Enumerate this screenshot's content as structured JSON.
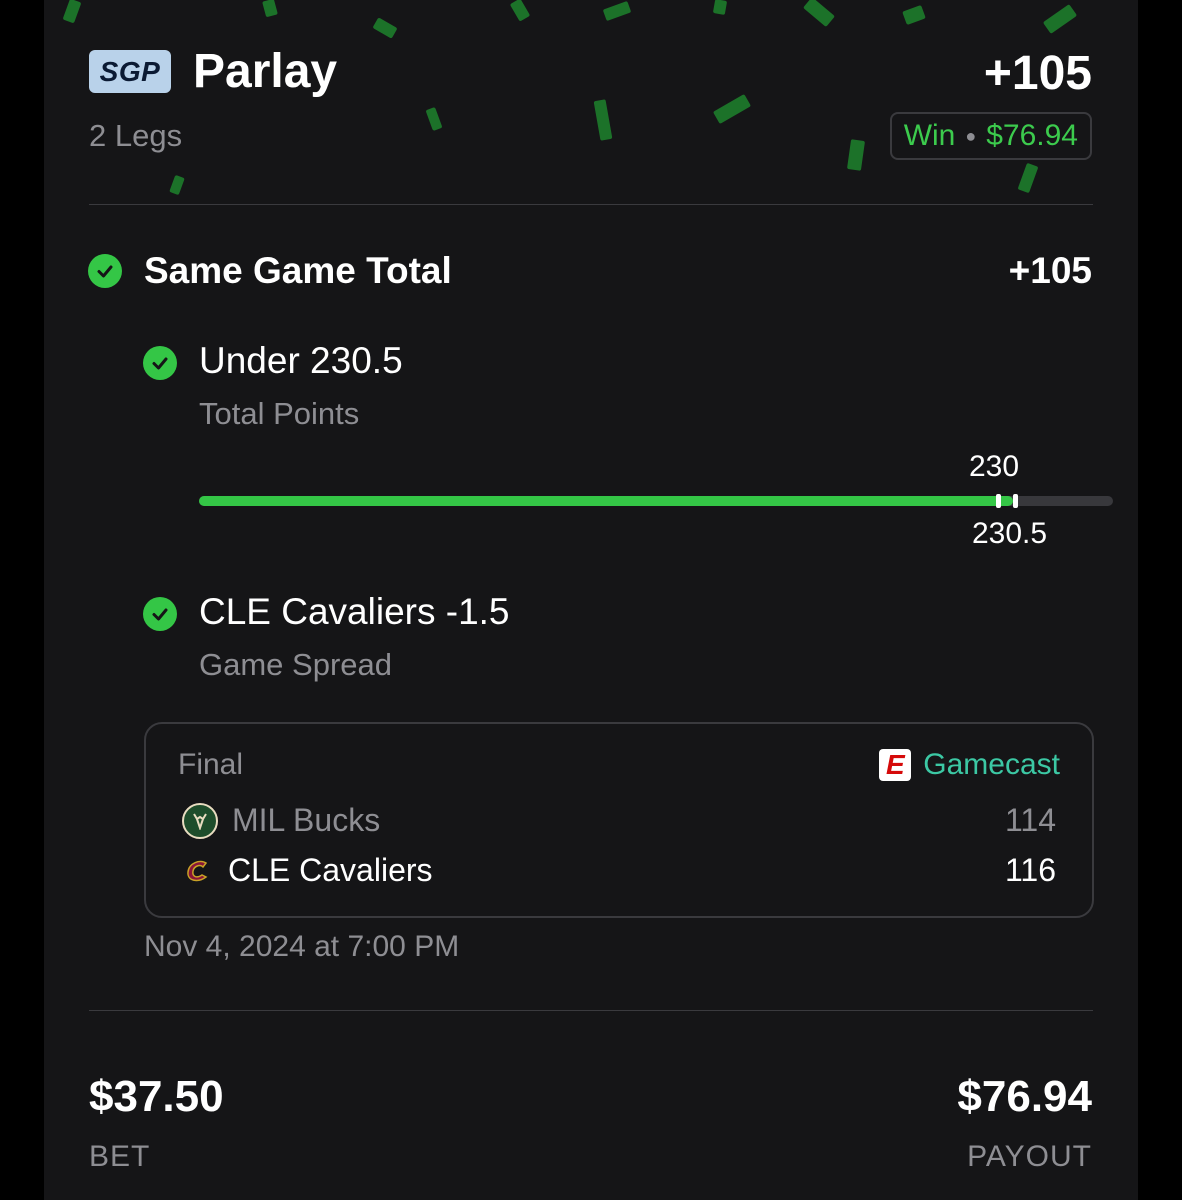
{
  "bet": {
    "badge": "SGP",
    "title": "Parlay",
    "legs_count": "2 Legs",
    "odds": "+105",
    "status": "Win",
    "status_amount": "$76.94"
  },
  "section": {
    "title": "Same Game Total",
    "odds": "+105"
  },
  "legs": [
    {
      "title": "Under 230.5",
      "subtitle": "Total Points",
      "progress": {
        "current": 230,
        "line": 230.5,
        "current_label": "230",
        "line_label": "230.5"
      }
    },
    {
      "title": "CLE Cavaliers -1.5",
      "subtitle": "Game Spread"
    }
  ],
  "game": {
    "status": "Final",
    "gamecast_label": "Gamecast",
    "espn_icon_letter": "E",
    "teams": [
      {
        "name": "MIL Bucks",
        "score": "114",
        "logo_icon": "bucks-logo-icon"
      },
      {
        "name": "CLE Cavaliers",
        "score": "116",
        "logo_icon": "cavaliers-logo-icon"
      }
    ],
    "date": "Nov 4, 2024 at 7:00 PM"
  },
  "totals": {
    "bet_amount": "$37.50",
    "bet_label": "BET",
    "payout_amount": "$76.94",
    "payout_label": "PAYOUT"
  },
  "colors": {
    "accent_green": "#34c646",
    "win_text": "#3ccb4d",
    "gamecast_teal": "#3cc8a4",
    "card_bg": "#151517"
  }
}
